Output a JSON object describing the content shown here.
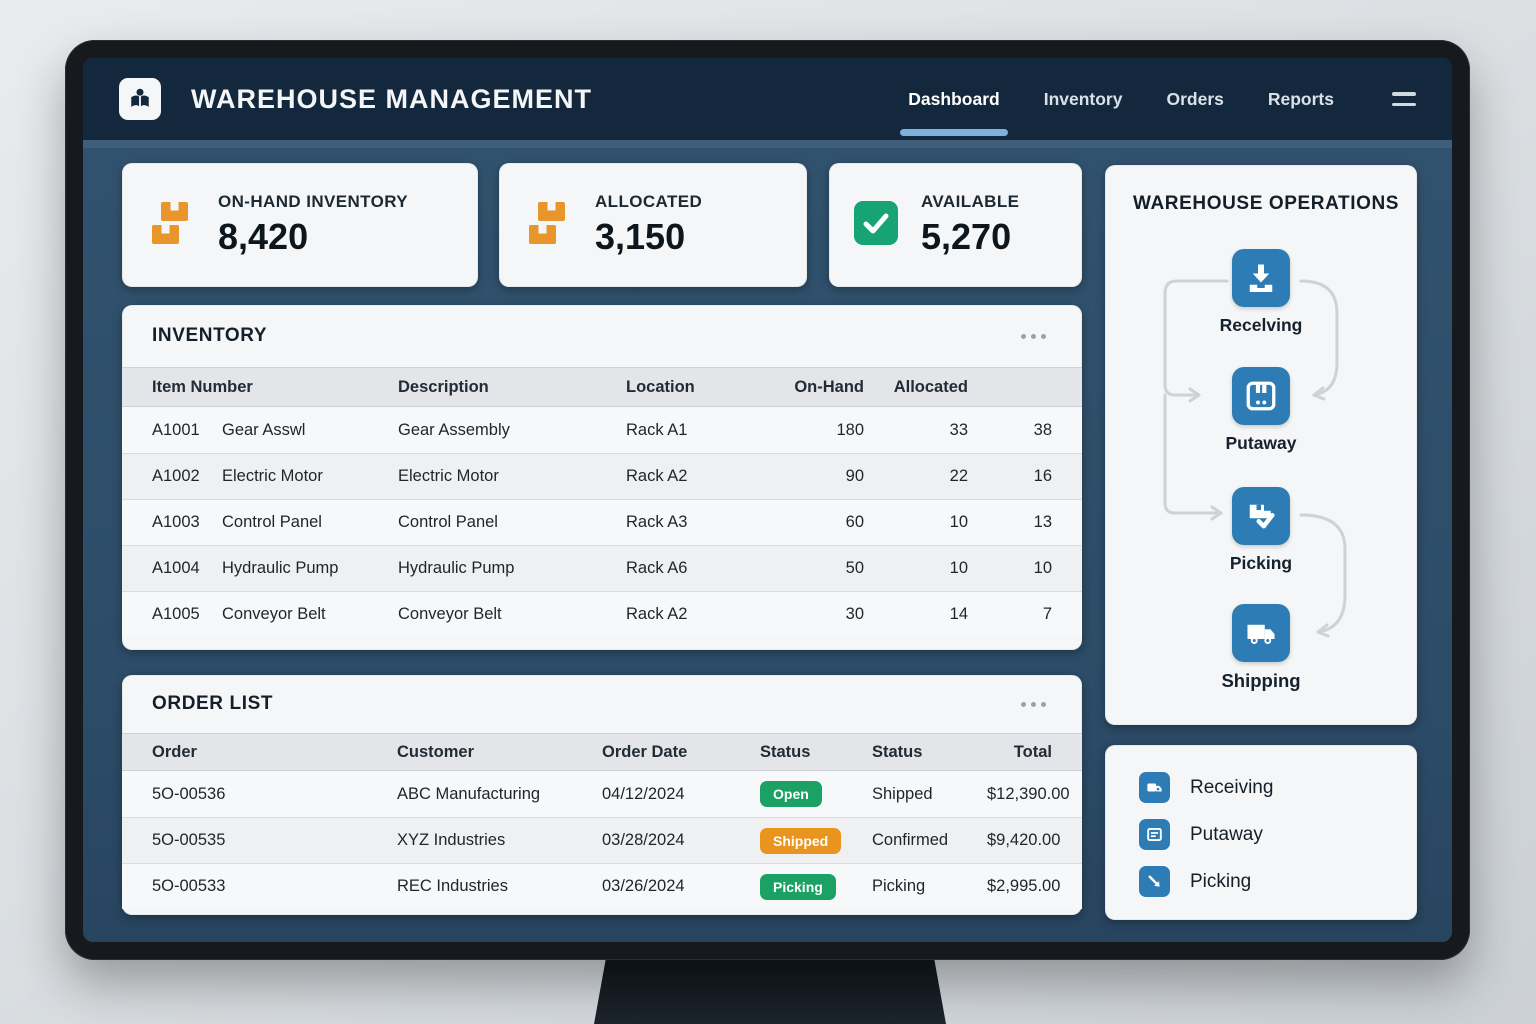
{
  "app": {
    "title": "WAREHOUSE MANAGEMENT"
  },
  "nav": {
    "items": [
      {
        "label": "Dashboard",
        "active": true
      },
      {
        "label": "Inventory",
        "active": false
      },
      {
        "label": "Orders",
        "active": false
      },
      {
        "label": "Reports",
        "active": false
      }
    ]
  },
  "stats": [
    {
      "label": "ON-HAND INVENTORY",
      "value": "8,420",
      "icon": "boxes-icon"
    },
    {
      "label": "ALLOCATED",
      "value": "3,150",
      "icon": "boxes-icon"
    },
    {
      "label": "AVAILABLE",
      "value": "5,270",
      "icon": "check-icon"
    }
  ],
  "inventory": {
    "title": "INVENTORY",
    "columns": [
      "Item Number",
      "Description",
      "Location",
      "On-Hand",
      "Allocated",
      ""
    ],
    "rows": [
      [
        "A1001",
        "Gear Asswl",
        "Gear Assembly",
        "Rack A1",
        "180",
        "33",
        "38"
      ],
      [
        "A1002",
        "Electric Motor",
        "Electric Motor",
        "Rack A2",
        "90",
        "22",
        "16"
      ],
      [
        "A1003",
        "Control Panel",
        "Control Panel",
        "Rack A3",
        "60",
        "10",
        "13"
      ],
      [
        "A1004",
        "Hydraulic Pump",
        "Hydraulic Pump",
        "Rack A6",
        "50",
        "10",
        "10"
      ],
      [
        "A1005",
        "Conveyor Belt",
        "Conveyor Belt",
        "Rack A2",
        "30",
        "14",
        "7"
      ]
    ]
  },
  "orders": {
    "title": "ORDER LIST",
    "columns": [
      "Order",
      "Customer",
      "Order Date",
      "Status",
      "Status",
      "Total"
    ],
    "rows": [
      {
        "order": "5O-00536",
        "customer": "ABC Manufacturing",
        "date": "04/12/2024",
        "badge": "Open",
        "badge_color": "#1BA163",
        "status": "Shipped",
        "total": "$12,390.00"
      },
      {
        "order": "5O-00535",
        "customer": "XYZ Industries",
        "date": "03/28/2024",
        "badge": "Shipped",
        "badge_color": "#E8941F",
        "status": "Confirmed",
        "total": "$9,420.00"
      },
      {
        "order": "5O-00533",
        "customer": "REC Industries",
        "date": "03/26/2024",
        "badge": "Picking",
        "badge_color": "#1BA163",
        "status": "Picking",
        "total": "$2,995.00"
      }
    ]
  },
  "operations": {
    "title": "WAREHOUSE OPERATIONS",
    "steps": [
      {
        "label": "Recelving",
        "icon": "receiving-icon"
      },
      {
        "label": "Putaway",
        "icon": "putaway-icon"
      },
      {
        "label": "Picking",
        "icon": "picking-icon"
      },
      {
        "label": "Shipping",
        "icon": "shipping-icon"
      }
    ]
  },
  "legend": {
    "items": [
      {
        "label": "Receiving",
        "icon": "receiving-small-icon"
      },
      {
        "label": "Putaway",
        "icon": "putaway-small-icon"
      },
      {
        "label": "Picking",
        "icon": "picking-small-icon"
      }
    ]
  },
  "colors": {
    "accent_blue": "#7DB2DE",
    "node_blue": "#2E7CB5",
    "status_green": "#1BA163",
    "status_orange": "#E8941F",
    "kpi_orange": "#E8952C",
    "kpi_green": "#17A373",
    "topbar_navy": "#13283C",
    "screen_slate": "#2F4F6B"
  }
}
